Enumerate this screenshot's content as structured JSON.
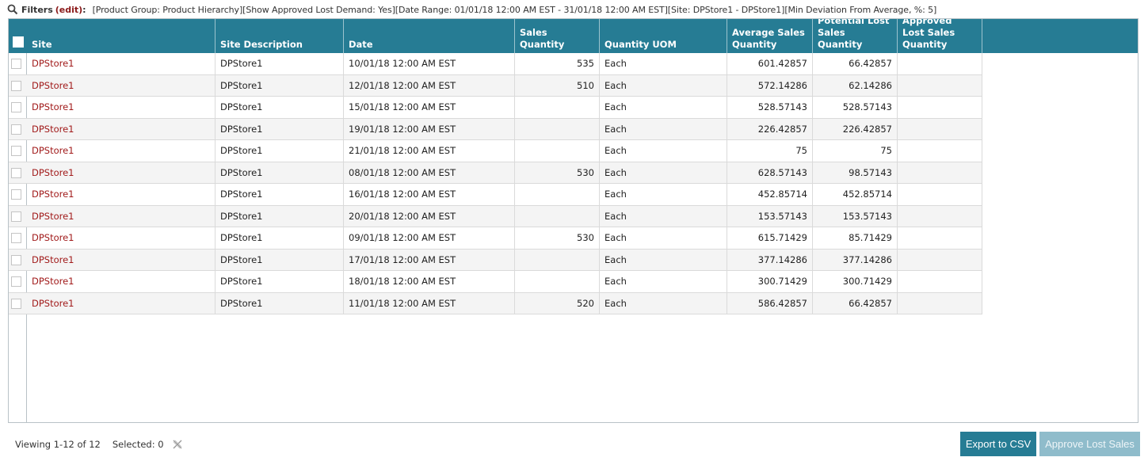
{
  "filters": {
    "label": "Filters",
    "edit": "(edit)",
    "colon": ":",
    "description": "[Product Group: Product Hierarchy][Show Approved Lost Demand: Yes][Date Range: 01/01/18 12:00 AM EST - 31/01/18 12:00 AM EST][Site: DPStore1 - DPStore1][Min Deviation From Average, %: 5]"
  },
  "table": {
    "columns": [
      {
        "key": "site",
        "label": "Site"
      },
      {
        "key": "site_description",
        "label": "Site Description"
      },
      {
        "key": "date",
        "label": "Date"
      },
      {
        "key": "sales_quantity",
        "label": "Sales Quantity"
      },
      {
        "key": "quantity_uom",
        "label": "Quantity UOM"
      },
      {
        "key": "average_sales_quantity",
        "label": "Average Sales Quantity"
      },
      {
        "key": "potential_lost_sales_quantity",
        "label": "Potential Lost Sales Quantity"
      },
      {
        "key": "approved_lost_sales_quantity",
        "label": "Approved Lost Sales Quantity"
      }
    ],
    "rows": [
      {
        "site": "DPStore1",
        "site_description": "DPStore1",
        "date": "10/01/18 12:00 AM EST",
        "sales_quantity": "535",
        "quantity_uom": "Each",
        "average_sales_quantity": "601.42857",
        "potential_lost_sales_quantity": "66.42857",
        "approved_lost_sales_quantity": ""
      },
      {
        "site": "DPStore1",
        "site_description": "DPStore1",
        "date": "12/01/18 12:00 AM EST",
        "sales_quantity": "510",
        "quantity_uom": "Each",
        "average_sales_quantity": "572.14286",
        "potential_lost_sales_quantity": "62.14286",
        "approved_lost_sales_quantity": ""
      },
      {
        "site": "DPStore1",
        "site_description": "DPStore1",
        "date": "15/01/18 12:00 AM EST",
        "sales_quantity": "",
        "quantity_uom": "Each",
        "average_sales_quantity": "528.57143",
        "potential_lost_sales_quantity": "528.57143",
        "approved_lost_sales_quantity": ""
      },
      {
        "site": "DPStore1",
        "site_description": "DPStore1",
        "date": "19/01/18 12:00 AM EST",
        "sales_quantity": "",
        "quantity_uom": "Each",
        "average_sales_quantity": "226.42857",
        "potential_lost_sales_quantity": "226.42857",
        "approved_lost_sales_quantity": ""
      },
      {
        "site": "DPStore1",
        "site_description": "DPStore1",
        "date": "21/01/18 12:00 AM EST",
        "sales_quantity": "",
        "quantity_uom": "Each",
        "average_sales_quantity": "75",
        "potential_lost_sales_quantity": "75",
        "approved_lost_sales_quantity": ""
      },
      {
        "site": "DPStore1",
        "site_description": "DPStore1",
        "date": "08/01/18 12:00 AM EST",
        "sales_quantity": "530",
        "quantity_uom": "Each",
        "average_sales_quantity": "628.57143",
        "potential_lost_sales_quantity": "98.57143",
        "approved_lost_sales_quantity": ""
      },
      {
        "site": "DPStore1",
        "site_description": "DPStore1",
        "date": "16/01/18 12:00 AM EST",
        "sales_quantity": "",
        "quantity_uom": "Each",
        "average_sales_quantity": "452.85714",
        "potential_lost_sales_quantity": "452.85714",
        "approved_lost_sales_quantity": ""
      },
      {
        "site": "DPStore1",
        "site_description": "DPStore1",
        "date": "20/01/18 12:00 AM EST",
        "sales_quantity": "",
        "quantity_uom": "Each",
        "average_sales_quantity": "153.57143",
        "potential_lost_sales_quantity": "153.57143",
        "approved_lost_sales_quantity": ""
      },
      {
        "site": "DPStore1",
        "site_description": "DPStore1",
        "date": "09/01/18 12:00 AM EST",
        "sales_quantity": "530",
        "quantity_uom": "Each",
        "average_sales_quantity": "615.71429",
        "potential_lost_sales_quantity": "85.71429",
        "approved_lost_sales_quantity": ""
      },
      {
        "site": "DPStore1",
        "site_description": "DPStore1",
        "date": "17/01/18 12:00 AM EST",
        "sales_quantity": "",
        "quantity_uom": "Each",
        "average_sales_quantity": "377.14286",
        "potential_lost_sales_quantity": "377.14286",
        "approved_lost_sales_quantity": ""
      },
      {
        "site": "DPStore1",
        "site_description": "DPStore1",
        "date": "18/01/18 12:00 AM EST",
        "sales_quantity": "",
        "quantity_uom": "Each",
        "average_sales_quantity": "300.71429",
        "potential_lost_sales_quantity": "300.71429",
        "approved_lost_sales_quantity": ""
      },
      {
        "site": "DPStore1",
        "site_description": "DPStore1",
        "date": "11/01/18 12:00 AM EST",
        "sales_quantity": "520",
        "quantity_uom": "Each",
        "average_sales_quantity": "586.42857",
        "potential_lost_sales_quantity": "66.42857",
        "approved_lost_sales_quantity": ""
      }
    ]
  },
  "footer": {
    "viewing": "Viewing 1-12 of 12",
    "selected": "Selected: 0"
  },
  "buttons": {
    "export_csv": "Export to CSV",
    "approve_lost_sales": "Approve Lost Sales"
  },
  "colors": {
    "header_bg": "#267c94",
    "site_link": "#a11a1a",
    "approve_disabled": "#8fbccb"
  },
  "icons": {
    "filters": "search-icon",
    "clear_selection": "clear-selection-icon"
  }
}
